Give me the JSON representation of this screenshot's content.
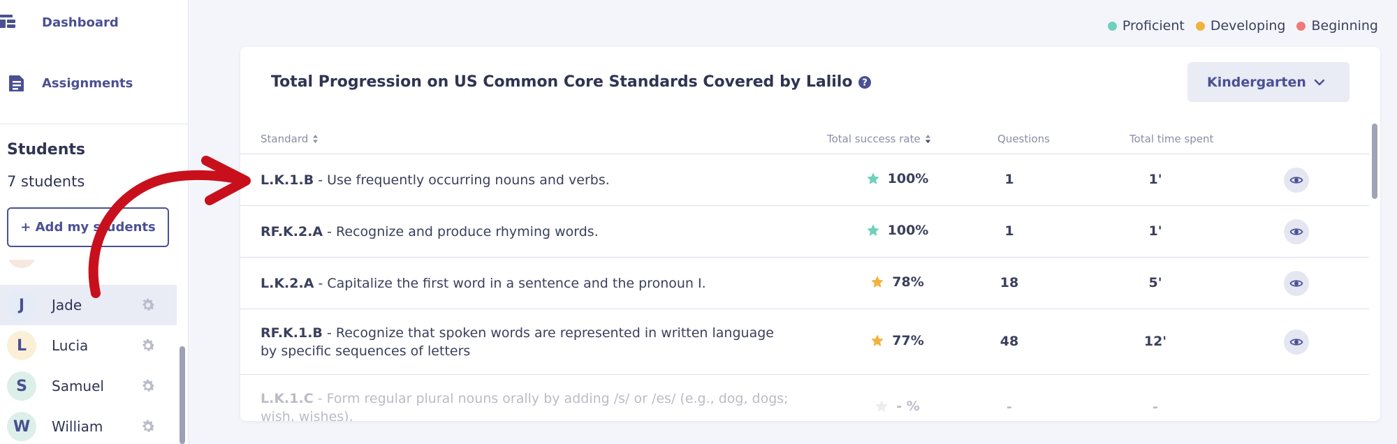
{
  "sidebar": {
    "nav": {
      "dashboard": "Dashboard",
      "assignments": "Assignments"
    },
    "students_title": "Students",
    "students_count": "7 students",
    "add_button": "+ Add my students",
    "students": [
      {
        "name": "Jade",
        "avatar_letter": "J",
        "avatar_color": "#e4ecf8",
        "active": true
      },
      {
        "name": "Lucia",
        "avatar_letter": "L",
        "avatar_color": "#fbf0d7",
        "active": false
      },
      {
        "name": "Samuel",
        "avatar_letter": "S",
        "avatar_color": "#dcefe8",
        "active": false
      },
      {
        "name": "William",
        "avatar_letter": "W",
        "avatar_color": "#dcefe8",
        "active": false
      }
    ]
  },
  "legend": [
    {
      "label": "Proficient",
      "color": "#6fd0bc"
    },
    {
      "label": "Developing",
      "color": "#f2b23e"
    },
    {
      "label": "Beginning",
      "color": "#f07a7a"
    }
  ],
  "card": {
    "title": "Total Progression on US Common Core Standards Covered by Lalilo",
    "grade_select": "Kindergarten",
    "columns": {
      "standard": "Standard",
      "success_rate": "Total success rate",
      "questions": "Questions",
      "time_spent": "Total time spent"
    },
    "rows": [
      {
        "code": "L.K.1.B",
        "desc": " - Use frequently occurring nouns and verbs.",
        "rate": "100%",
        "star": "proficient",
        "questions": "1",
        "time": "1'"
      },
      {
        "code": "RF.K.2.A",
        "desc": " - Recognize and produce rhyming words.",
        "rate": "100%",
        "star": "proficient",
        "questions": "1",
        "time": "1'"
      },
      {
        "code": "L.K.2.A",
        "desc": " - Capitalize the first word in a sentence and the pronoun I.",
        "rate": "78%",
        "star": "developing",
        "questions": "18",
        "time": "5'"
      },
      {
        "code": "RF.K.1.B",
        "desc": " - Recognize that spoken words are represented in written language by specific sequences of letters",
        "rate": "77%",
        "star": "developing",
        "questions": "48",
        "time": "12'"
      },
      {
        "code": "L.K.1.C",
        "desc": " - Form regular plural nouns orally by adding /s/ or /es/ (e.g., dog, dogs; wish, wishes).",
        "rate": "- %",
        "star": "none",
        "questions": "-",
        "time": "-"
      }
    ]
  },
  "colors": {
    "accent": "#4a5092",
    "proficient": "#6fd0bc",
    "developing": "#f2b23e",
    "beginning": "#f07a7a",
    "annotation_arrow": "#c8101c"
  }
}
